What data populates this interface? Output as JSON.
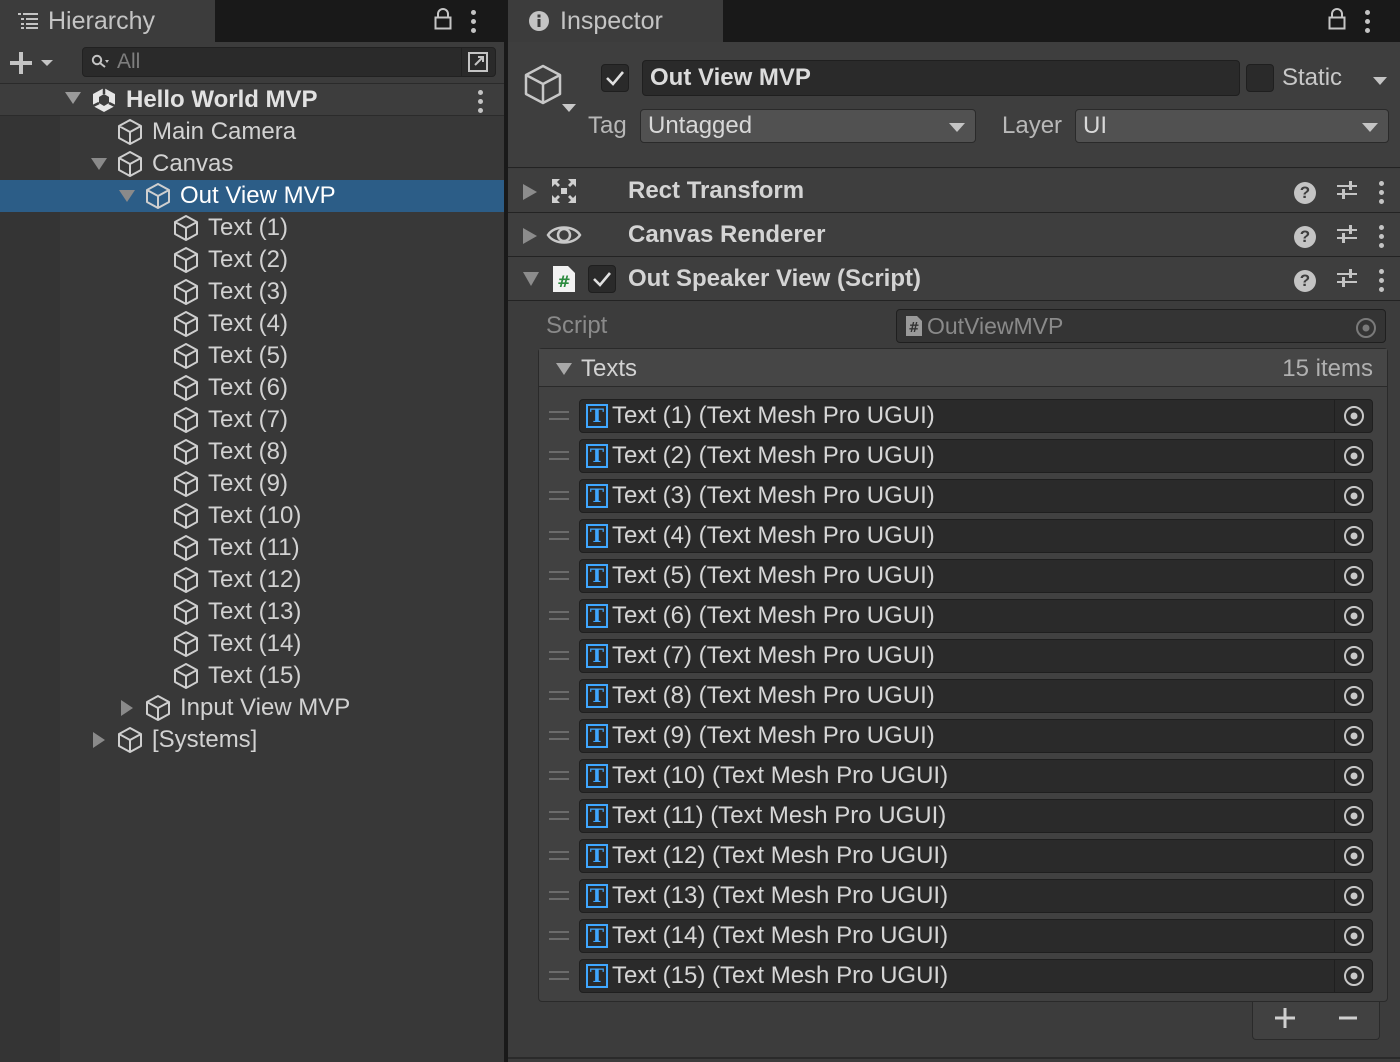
{
  "hierarchy": {
    "tab_label": "Hierarchy",
    "search_placeholder": "All",
    "scene": "Hello World MVP",
    "items": [
      {
        "label": "Main Camera"
      },
      {
        "label": "Canvas"
      },
      {
        "label": "Out View MVP"
      },
      {
        "label": "Text (1)"
      },
      {
        "label": "Text (2)"
      },
      {
        "label": "Text (3)"
      },
      {
        "label": "Text (4)"
      },
      {
        "label": "Text (5)"
      },
      {
        "label": "Text (6)"
      },
      {
        "label": "Text (7)"
      },
      {
        "label": "Text (8)"
      },
      {
        "label": "Text (9)"
      },
      {
        "label": "Text (10)"
      },
      {
        "label": "Text (11)"
      },
      {
        "label": "Text (12)"
      },
      {
        "label": "Text (13)"
      },
      {
        "label": "Text (14)"
      },
      {
        "label": "Text (15)"
      },
      {
        "label": "Input View MVP"
      },
      {
        "label": "[Systems]"
      }
    ],
    "selected": "Out View MVP"
  },
  "inspector": {
    "tab_label": "Inspector",
    "object_name": "Out View MVP",
    "active": true,
    "static_label": "Static",
    "tag_label": "Tag",
    "tag_value": "Untagged",
    "layer_label": "Layer",
    "layer_value": "UI",
    "components": [
      {
        "title": "Rect Transform",
        "icon": "rect-transform-icon",
        "expanded": false
      },
      {
        "title": "Canvas Renderer",
        "icon": "eye-icon",
        "expanded": false
      },
      {
        "title": "Out Speaker View (Script)",
        "icon": "script-icon",
        "expanded": true,
        "enabled": true
      }
    ],
    "script": {
      "label": "Script",
      "value": "OutViewMVP"
    },
    "texts": {
      "label": "Texts",
      "count": "15 items",
      "items": [
        "Text (1) (Text Mesh Pro UGUI)",
        "Text (2) (Text Mesh Pro UGUI)",
        "Text (3) (Text Mesh Pro UGUI)",
        "Text (4) (Text Mesh Pro UGUI)",
        "Text (5) (Text Mesh Pro UGUI)",
        "Text (6) (Text Mesh Pro UGUI)",
        "Text (7) (Text Mesh Pro UGUI)",
        "Text (8) (Text Mesh Pro UGUI)",
        "Text (9) (Text Mesh Pro UGUI)",
        "Text (10) (Text Mesh Pro UGUI)",
        "Text (11) (Text Mesh Pro UGUI)",
        "Text (12) (Text Mesh Pro UGUI)",
        "Text (13) (Text Mesh Pro UGUI)",
        "Text (14) (Text Mesh Pro UGUI)",
        "Text (15) (Text Mesh Pro UGUI)"
      ]
    }
  },
  "colors": {
    "selection": "#2c5d87",
    "tmp_icon": "#3fa7ff",
    "panel": "#383838"
  }
}
